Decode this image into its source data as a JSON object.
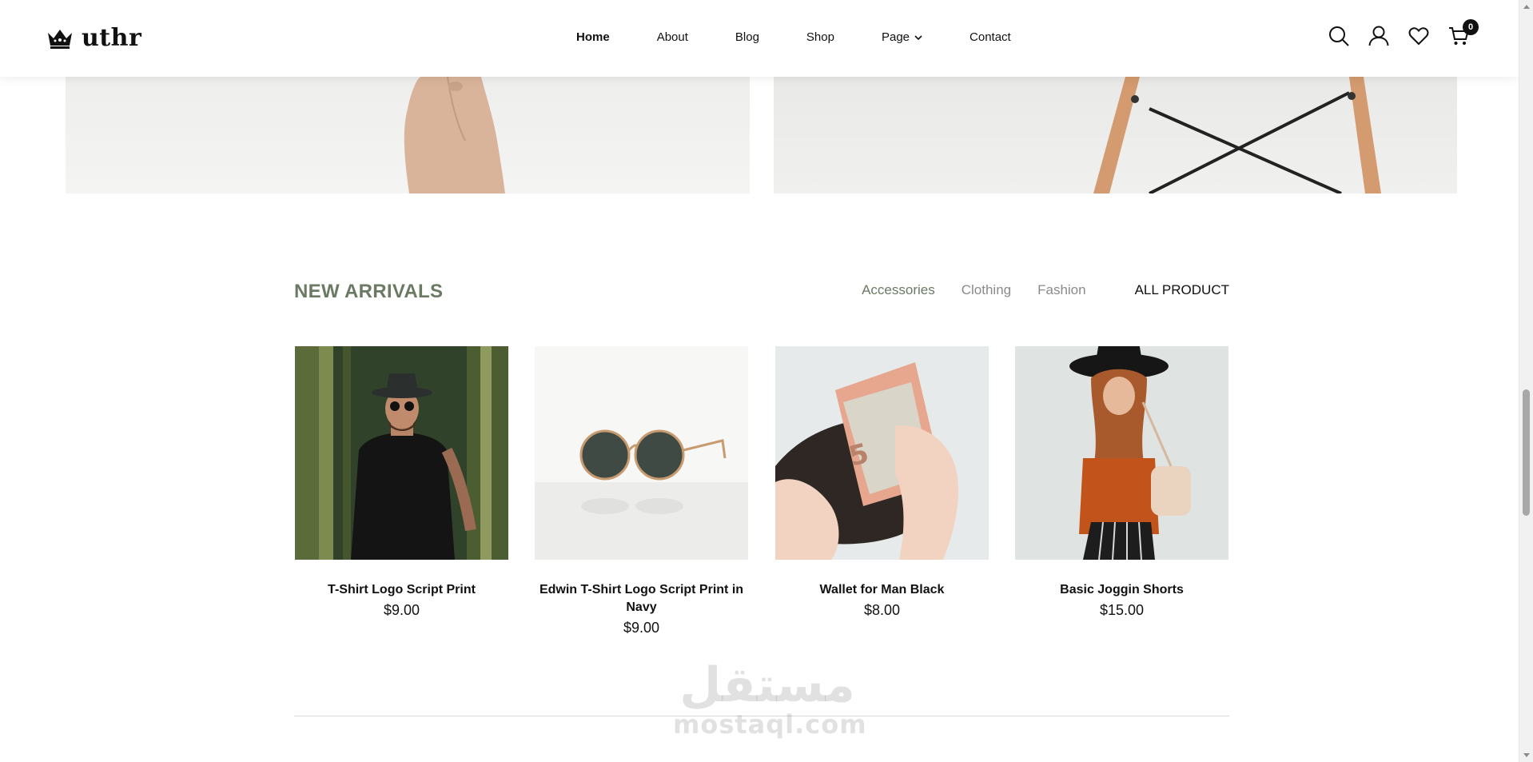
{
  "header": {
    "logo_text": "uthr",
    "nav": [
      {
        "label": "Home",
        "active": true
      },
      {
        "label": "About"
      },
      {
        "label": "Blog"
      },
      {
        "label": "Shop"
      },
      {
        "label": "Page",
        "has_dropdown": true
      },
      {
        "label": "Contact"
      }
    ],
    "icons": [
      "search-icon",
      "user-icon",
      "heart-icon",
      "cart-icon"
    ],
    "cart_count": "0"
  },
  "section": {
    "title": "NEW ARRIVALS",
    "filters": [
      "Accessories",
      "Clothing",
      "Fashion"
    ],
    "all_label": "ALL PRODUCT"
  },
  "products": [
    {
      "name": "T-Shirt Logo Script Print",
      "price": "$9.00"
    },
    {
      "name": "Edwin T-Shirt Logo Script Print in Navy",
      "price": "$9.00"
    },
    {
      "name": "Wallet for Man Black",
      "price": "$8.00"
    },
    {
      "name": "Basic Joggin Shorts",
      "price": "$15.00"
    }
  ],
  "watermark": {
    "arabic": "مستقل",
    "latin": "mostaql.com"
  },
  "colors": {
    "accent": "#6b7a63",
    "filter_inactive": "#8a8a8a",
    "text": "#111111"
  }
}
